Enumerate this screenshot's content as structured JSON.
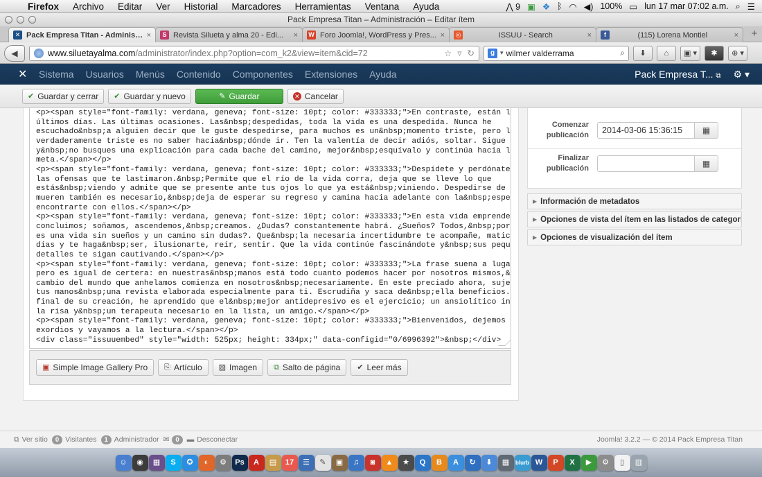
{
  "macmenu": {
    "app": "Firefox",
    "items": [
      "Archivo",
      "Editar",
      "Ver",
      "Historial",
      "Marcadores",
      "Herramientas",
      "Ventana",
      "Ayuda"
    ],
    "adobe_count": "9",
    "battery": "100%",
    "datetime": "lun 17 mar  07:02 a.m."
  },
  "window": {
    "title": "Pack Empresa Titan – Administración – Editar ítem"
  },
  "tabs": [
    {
      "label": "Pack Empresa Titan - Administ...",
      "fav_color": "#1b4f86",
      "fav_glyph": "✕",
      "active": true
    },
    {
      "label": "Revista Silueta y alma 20 - Edi...",
      "fav_color": "#c0396b",
      "fav_glyph": "S",
      "active": false
    },
    {
      "label": "Foro Joomla!, WordPress y Pres...",
      "fav_color": "#d8422a",
      "fav_glyph": "W",
      "active": false
    },
    {
      "label": "ISSUU - Search",
      "fav_color": "#e8572a",
      "fav_glyph": "◎",
      "active": false
    },
    {
      "label": "(115) Lorena Montiel",
      "fav_color": "#3b5998",
      "fav_glyph": "f",
      "active": false
    }
  ],
  "nav": {
    "url_host": "www.siluetayalma.com",
    "url_path": "/administrator/index.php?option=com_k2&view=item&cid=72",
    "search_value": "wilmer valderrama"
  },
  "jnav": {
    "menus": [
      "Sistema",
      "Usuarios",
      "Menús",
      "Contenido",
      "Componentes",
      "Extensiones",
      "Ayuda"
    ],
    "site_name": "Pack Empresa T..."
  },
  "toolbar": {
    "save_close": "Guardar y cerrar",
    "save_new": "Guardar y nuevo",
    "save": "Guardar",
    "cancel": "Cancelar"
  },
  "editor": {
    "lines": [
      "<p><span style=\"font-family: verdana, geneva; font-size: 10pt; color: #333333;\">En contraste, están los",
      "últimos días. Las últimas ocasiones. Las&nbsp;despedidas, toda la vida es una despedida. Nunca he",
      "escuchado&nbsp;a alguien decir que le guste despedirse, para muchos es un&nbsp;momento triste, pero lo",
      "verdaderamente triste es no saber hacia&nbsp;dónde ir. Ten la valentía de decir adiós, soltar. Sigue en marcha",
      "y&nbsp;no busques una explicación para cada bache del camino, mejor&nbsp;esquívalo y continúa hacia la",
      "meta.</span></p>",
      "<p><span style=\"font-family: verdana, geneva; font-size: 10pt; color: #333333;\">Despídete y perdónate. Suelta",
      "las ofensas que te lastimaron.&nbsp;Permite que el río de la vida corra, deja que se lleve lo que",
      "estás&nbsp;viendo y admite que se presente ante tus ojos lo que ya está&nbsp;viniendo. Despedirse de los que",
      "mueren también es necesario,&nbsp;deja de esperar su regreso y camina hacia adelante con la&nbsp;esperanza de",
      "encontrarte con ellos.</span></p>",
      "<p><span style=\"font-family: verdana, geneva; font-size: 10pt; color: #333333;\">En esta vida emprendemos y",
      "concluimos; soñamos, ascendemos,&nbsp;creamos. ¿Dudas? constantemente habrá. ¿Sueños? Todos,&nbsp;porque: ¿qué",
      "es una vida sin sueños y un camino sin dudas?. Que&nbsp;la necesaria incertidumbre te acompañe, matice tus",
      "días y te haga&nbsp;ser, ilusionarte, reír, sentir. Que la vida continúe fascinándote y&nbsp;sus pequeños",
      "detalles te sigan cautivando.</span></p>",
      "<p><span style=\"font-family: verdana, geneva; font-size: 10pt; color: #333333;\">La frase suena a lugar común",
      "pero es igual de certera: en nuestras&nbsp;manos está todo cuanto podemos hacer por nosotros mismos,&nbsp;y el",
      "cambio del mundo que anhelamos comienza en nosotros&nbsp;necesariamente. En este preciado ahora, sujetas con",
      "tus manos&nbsp;una revista elaborada especialmente para ti. Escrudiña y saca de&nbsp;ella beneficios. Yo, al",
      "final de su creación, he aprendido que el&nbsp;mejor antidepresivo es el ejercicio; un ansiolítico infalible,",
      "la risa y&nbsp;un terapeuta necesario en la lista, un amigo.</span></p>",
      "<p><span style=\"font-family: verdana, geneva; font-size: 10pt; color: #333333;\">Bienvenidos, dejemos los",
      "exordios y vayamos a la lectura.</span></p>",
      "<div class=\"issuuembed\" style=\"width: 525px; height: 334px;\" data-configid=\"0/6996392\">&nbsp;</div>"
    ]
  },
  "editor_buttons": {
    "gallery": "Simple Image Gallery Pro",
    "article": "Artículo",
    "image": "Imagen",
    "pagebreak": "Salto de página",
    "readmore": "Leer más"
  },
  "publishing": {
    "start_label_1": "Comenzar",
    "start_label_2": "publicación",
    "start_value": "2014-03-06 15:36:15",
    "end_label_1": "Finalizar",
    "end_label_2": "publicación",
    "end_value": ""
  },
  "accordion": [
    "Información de metadatos",
    "Opciones de vista del ítem en las listados de categoría",
    "Opciones de visualización del ítem"
  ],
  "status": {
    "view_site": "Ver sitio",
    "visitors_count": "0",
    "visitors_label": "Visitantes",
    "admin_count": "1",
    "admin_label": "Administrador",
    "messages_count": "0",
    "logout": "Desconectar",
    "version": "Joomla! 3.2.2  —  © 2014 Pack Empresa Titan"
  },
  "dock": [
    {
      "name": "finder",
      "color": "#4a7fd0",
      "glyph": "☺"
    },
    {
      "name": "dashboard",
      "color": "#3c3c3c",
      "glyph": "◉"
    },
    {
      "name": "mission-control",
      "color": "#6a4f8a",
      "glyph": "▦"
    },
    {
      "name": "skype",
      "color": "#0aaef0",
      "glyph": "S"
    },
    {
      "name": "safari",
      "color": "#2d8ee0",
      "glyph": "✪"
    },
    {
      "name": "firefox",
      "color": "#e0662a",
      "glyph": "◐"
    },
    {
      "name": "system-preferences",
      "color": "#7d7d7d",
      "glyph": "⚙"
    },
    {
      "name": "photoshop",
      "color": "#102a4c",
      "glyph": "Ps"
    },
    {
      "name": "acrobat",
      "color": "#c8281e",
      "glyph": "A"
    },
    {
      "name": "folder",
      "color": "#c79a4a",
      "glyph": "▤"
    },
    {
      "name": "calendar",
      "color": "#e85a4f",
      "glyph": "17"
    },
    {
      "name": "notes",
      "color": "#3d6fb5",
      "glyph": "☰"
    },
    {
      "name": "textedit",
      "color": "#e3e3e3",
      "glyph": "✎"
    },
    {
      "name": "preview",
      "color": "#8a6a44",
      "glyph": "▣"
    },
    {
      "name": "itunes",
      "color": "#3a75c4",
      "glyph": "♫"
    },
    {
      "name": "photo-booth",
      "color": "#c8342c",
      "glyph": "◙"
    },
    {
      "name": "vlc",
      "color": "#f08a1a",
      "glyph": "▲"
    },
    {
      "name": "imovie",
      "color": "#4b4b4b",
      "glyph": "★"
    },
    {
      "name": "quicktime",
      "color": "#2c76c9",
      "glyph": "Q"
    },
    {
      "name": "ibooks",
      "color": "#e68a1e",
      "glyph": "B"
    },
    {
      "name": "app-store",
      "color": "#3c8fdc",
      "glyph": "A"
    },
    {
      "name": "migration",
      "color": "#2e6fc0",
      "glyph": "↻"
    },
    {
      "name": "downloads",
      "color": "#4c8ad8",
      "glyph": "⬇"
    },
    {
      "name": "calculator",
      "color": "#606a74",
      "glyph": "▦"
    },
    {
      "name": "blurb",
      "color": "#3a9bd0",
      "glyph": "blurb"
    },
    {
      "name": "word",
      "color": "#2b5797",
      "glyph": "W"
    },
    {
      "name": "powerpoint",
      "color": "#d24726",
      "glyph": "P"
    },
    {
      "name": "excel",
      "color": "#207245",
      "glyph": "X"
    },
    {
      "name": "media-player",
      "color": "#3c9a3c",
      "glyph": "▶"
    },
    {
      "name": "settings",
      "color": "#8c8c8c",
      "glyph": "⚙"
    },
    {
      "name": "document",
      "color": "#f2f2f2",
      "glyph": "▯"
    },
    {
      "name": "trash",
      "color": "#9aa4ae",
      "glyph": "▥"
    }
  ]
}
